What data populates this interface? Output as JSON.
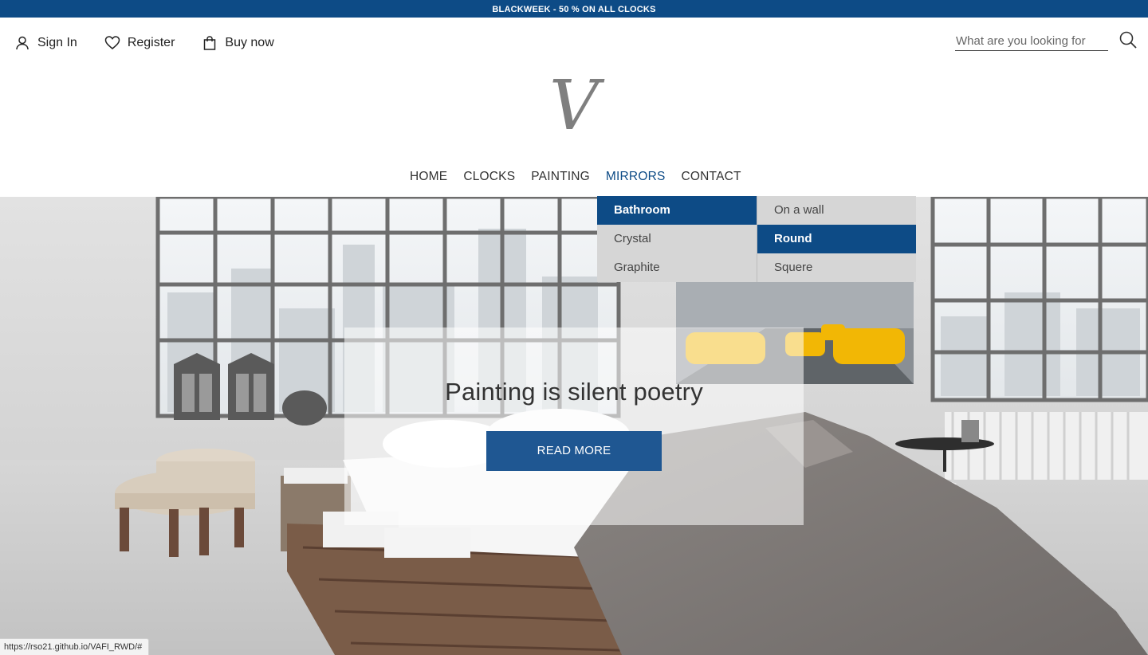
{
  "promo_bar": {
    "text": "BLACKWEEK - 50 % ON ALL CLOCKS"
  },
  "account": {
    "items": [
      {
        "label": "Sign In",
        "icon": "user-icon"
      },
      {
        "label": "Register",
        "icon": "heart-icon"
      },
      {
        "label": "Buy now",
        "icon": "shopping-bag-icon"
      }
    ]
  },
  "search": {
    "placeholder": "What are you looking for",
    "icon": "search-icon"
  },
  "logo": {
    "glyph": "V"
  },
  "nav": {
    "items": [
      {
        "label": "HOME"
      },
      {
        "label": "CLOCKS"
      },
      {
        "label": "PAINTING"
      },
      {
        "label": "MIRRORS",
        "active": true
      },
      {
        "label": "CONTACT"
      }
    ]
  },
  "mirrors_menu": {
    "primary": [
      {
        "label": "Bathroom",
        "highlighted": true
      },
      {
        "label": "Crystal"
      },
      {
        "label": "Graphite"
      }
    ],
    "secondary": [
      {
        "label": "On a wall"
      },
      {
        "label": "Round",
        "highlighted": true
      },
      {
        "label": "Squere"
      }
    ]
  },
  "hero": {
    "title": "Painting is silent poetry",
    "button": "READ MORE"
  },
  "status_bar": {
    "url": "https://rso21.github.io/VAFI_RWD/#"
  },
  "colors": {
    "brand_blue": "#0d4b86",
    "button_blue": "#1f5792",
    "menu_gray": "#d6d6d6"
  }
}
